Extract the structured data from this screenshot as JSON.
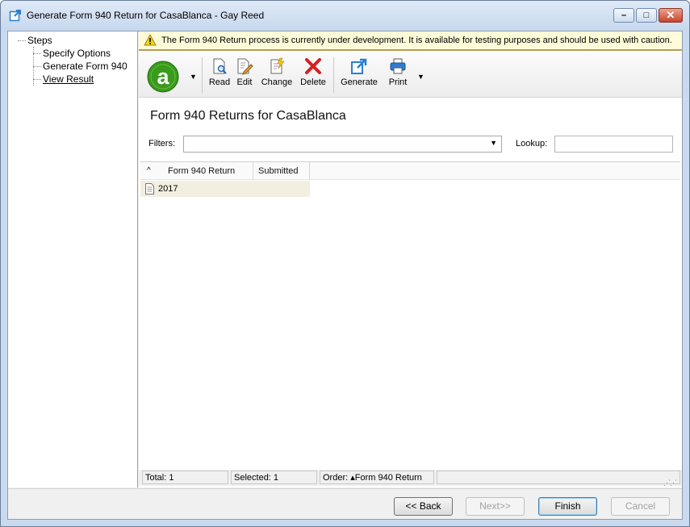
{
  "window": {
    "title": "Generate Form 940 Return for CasaBlanca - Gay Reed",
    "controls": {
      "minimize": "–",
      "maximize": "□",
      "close": "✕"
    }
  },
  "steps": {
    "root": "Steps",
    "items": [
      {
        "label": "Specify Options"
      },
      {
        "label": "Generate Form 940"
      },
      {
        "label": "View Result",
        "current": true
      }
    ]
  },
  "warning": {
    "text": "The Form 940 Return process is currently under development. It is available for testing purposes and should be used with caution.",
    "icon": "warning-icon"
  },
  "toolbar": {
    "buttons": [
      {
        "label": "Read",
        "icon": "read-icon"
      },
      {
        "label": "Edit",
        "icon": "edit-icon"
      },
      {
        "label": "Change",
        "icon": "change-icon"
      },
      {
        "label": "Delete",
        "icon": "delete-icon"
      },
      {
        "label": "Generate",
        "icon": "generate-icon"
      },
      {
        "label": "Print",
        "icon": "print-icon"
      }
    ],
    "logo_letter": "a",
    "colors": {
      "logo_green": "#3a9a1c",
      "delete_red": "#d81f1f",
      "accent_blue": "#2a7fd0"
    }
  },
  "main": {
    "heading": "Form 940 Returns for CasaBlanca",
    "filters_label": "Filters:",
    "filters_value": "",
    "lookup_label": "Lookup:",
    "lookup_value": ""
  },
  "grid": {
    "columns": [
      "Form 940 Return",
      "Submitted"
    ],
    "rows": [
      {
        "form_940_return": "2017",
        "submitted": ""
      }
    ]
  },
  "status": {
    "total": "Total: 1",
    "selected": "Selected: 1",
    "order": "Order: ▴Form 940 Return"
  },
  "footer": {
    "back": "<< Back",
    "next": "Next>>",
    "finish": "Finish",
    "cancel": "Cancel"
  }
}
